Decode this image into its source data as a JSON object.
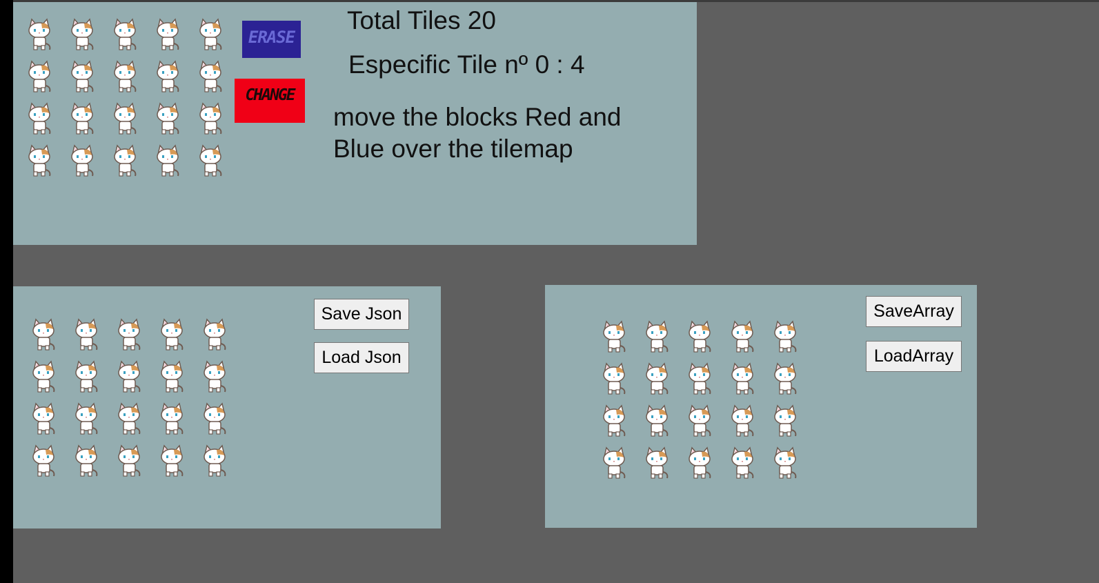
{
  "colors": {
    "background": "#5f5f5f",
    "panel": "#94adb0",
    "erase_block": "#2b2294",
    "change_block": "#f00016"
  },
  "tile_icon": "cat-sprite-icon",
  "top_panel": {
    "total_tiles_text": "Total Tiles 20",
    "especific_tile_text": "Especific Tile nº 0 : 4",
    "instructions_text": "move the blocks Red and Blue over the tilemap",
    "erase_label": "ERASE",
    "change_label": "CHANGE"
  },
  "json_panel": {
    "save_label": "Save Json",
    "load_label": "Load Json"
  },
  "array_panel": {
    "save_label": "SaveArray",
    "load_label": "LoadArray"
  }
}
